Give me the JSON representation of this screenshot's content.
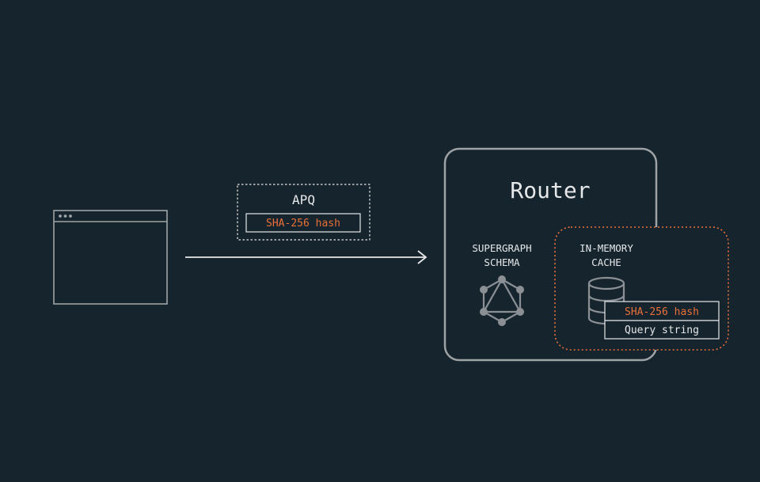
{
  "colors": {
    "background": "#16242e",
    "outline": "#9ea3a6",
    "text": "#e6e8e9",
    "accent": "#e9703a",
    "icon": "#8b9094"
  },
  "client": {
    "icon": "browser-window-icon"
  },
  "request": {
    "title": "APQ",
    "hash_label": "SHA-256 hash"
  },
  "router": {
    "title": "Router",
    "schema_label_line1": "SUPERGRAPH",
    "schema_label_line2": "SCHEMA",
    "schema_icon": "graphql-icon"
  },
  "cache": {
    "label_line1": "IN-MEMORY",
    "label_line2": "CACHE",
    "icon": "database-icon",
    "entry_hash": "SHA-256 hash",
    "entry_query": "Query string"
  }
}
